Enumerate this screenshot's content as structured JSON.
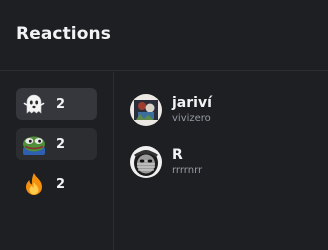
{
  "header": {
    "title": "Reactions"
  },
  "reactions": [
    {
      "emoji": "ghost-emoji",
      "count": "2",
      "state": "selected"
    },
    {
      "emoji": "pepe-frog-emoji",
      "count": "2",
      "state": "hover"
    },
    {
      "emoji": "fire-emoji",
      "count": "2",
      "state": "normal"
    }
  ],
  "users": [
    {
      "display_name": "jariví",
      "username": "vivizero"
    },
    {
      "display_name": "R",
      "username": "rrrrnrr"
    }
  ],
  "colors": {
    "background": "#1e1f22",
    "selected": "#35373c",
    "divider": "#2b2d31",
    "muted_text": "#949ba4"
  }
}
